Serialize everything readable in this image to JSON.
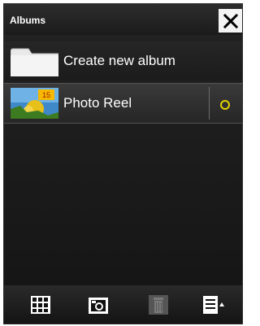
{
  "window": {
    "title": "Albums"
  },
  "albums": [
    {
      "label": "Create new album",
      "thumb_icon": "folder-icon"
    },
    {
      "label": "Photo Reel",
      "thumb_icon": "photo-thumbnail-icon",
      "badge": "15",
      "status_icon": "circle-icon"
    }
  ],
  "toolbar": {
    "buttons": [
      {
        "icon": "grid-icon"
      },
      {
        "icon": "camera-icon"
      },
      {
        "icon": "trash-icon",
        "disabled": true
      },
      {
        "icon": "list-menu-icon"
      }
    ]
  },
  "colors": {
    "background": "#1b1b1b",
    "status": "#e2d400",
    "text": "#ffffff"
  }
}
